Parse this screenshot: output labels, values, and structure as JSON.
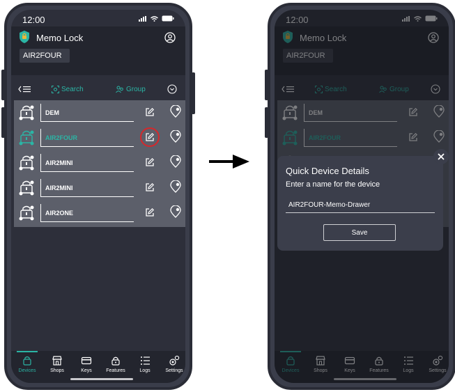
{
  "status": {
    "time": "12:00"
  },
  "app": {
    "title": "Memo Lock",
    "selected_device": "AIR2FOUR"
  },
  "toolbar": {
    "search_label": "Search",
    "group_label": "Group"
  },
  "devices": [
    {
      "name": "DEM",
      "active": false
    },
    {
      "name": "AIR2FOUR",
      "active": true
    },
    {
      "name": "AIR2MINI",
      "active": false
    },
    {
      "name": "AIR2MINI",
      "active": false
    },
    {
      "name": "AIR2ONE",
      "active": false
    }
  ],
  "tabs": [
    "Devices",
    "Shops",
    "Keys",
    "Features",
    "Logs",
    "Settings"
  ],
  "dialog": {
    "title": "Quick Device Details",
    "subtitle": "Enter a name for the device",
    "input_value": "AIR2FOUR-Memo-Drawer",
    "save_label": "Save"
  },
  "colors": {
    "accent": "#2bb5a5",
    "highlight": "#d4282c",
    "panel": "#3b3e4b"
  }
}
